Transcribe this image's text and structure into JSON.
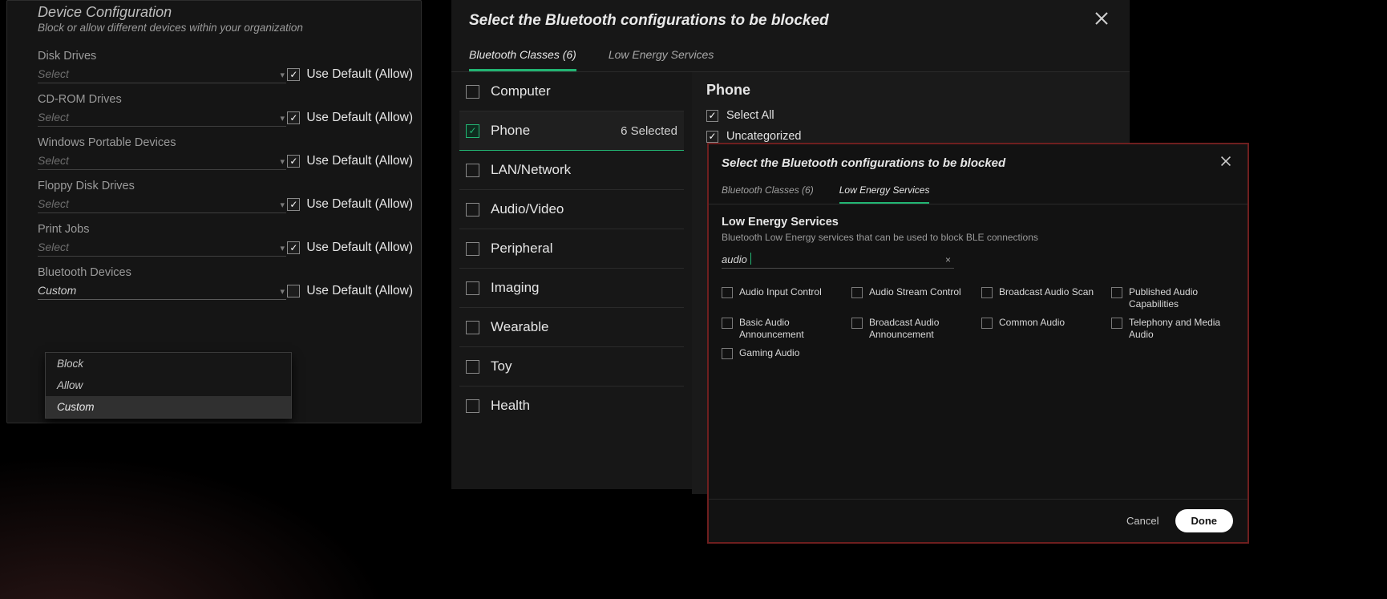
{
  "panel1": {
    "title": "Device Configuration",
    "subtitle": "Block or allow different devices within your organization",
    "select_placeholder": "Select",
    "default_label": "Use Default (Allow)",
    "fields": [
      {
        "label": "Disk Drives",
        "value": "",
        "default_checked": true
      },
      {
        "label": "CD-ROM Drives",
        "value": "",
        "default_checked": true
      },
      {
        "label": "Windows Portable Devices",
        "value": "",
        "default_checked": true
      },
      {
        "label": "Floppy Disk Drives",
        "value": "",
        "default_checked": true
      },
      {
        "label": "Print Jobs",
        "value": "",
        "default_checked": true
      },
      {
        "label": "Bluetooth Devices",
        "value": "Custom",
        "default_checked": false
      }
    ],
    "dropdown": [
      "Block",
      "Allow",
      "Custom"
    ],
    "dropdown_selected": "Custom"
  },
  "panel2": {
    "title": "Select the Bluetooth configurations to be blocked",
    "tabs": {
      "classes": "Bluetooth Classes  (6)",
      "les": "Low Energy Services"
    },
    "classes": [
      {
        "label": "Computer",
        "checked": false
      },
      {
        "label": "Phone",
        "checked": true,
        "count": "6 Selected"
      },
      {
        "label": "LAN/Network",
        "checked": false
      },
      {
        "label": "Audio/Video",
        "checked": false
      },
      {
        "label": "Peripheral",
        "checked": false
      },
      {
        "label": "Imaging",
        "checked": false
      },
      {
        "label": "Wearable",
        "checked": false
      },
      {
        "label": "Toy",
        "checked": false
      },
      {
        "label": "Health",
        "checked": false
      }
    ],
    "detail": {
      "title": "Phone",
      "select_all": "Select All",
      "items": [
        "Uncategorized"
      ]
    }
  },
  "panel3": {
    "title": "Select the Bluetooth configurations to be blocked",
    "tabs": {
      "classes": "Bluetooth Classes  (6)",
      "les": "Low Energy Services"
    },
    "section_title": "Low Energy Services",
    "section_sub": "Bluetooth Low Energy services that can be used to block BLE connections",
    "search_value": "audio",
    "services": [
      "Audio Input Control",
      "Audio Stream Control",
      "Broadcast Audio Scan",
      "Published Audio Capabilities",
      "Basic Audio Announcement",
      "Broadcast Audio Announcement",
      "Common Audio",
      "Telephony and Media Audio",
      "Gaming Audio"
    ],
    "cancel": "Cancel",
    "done": "Done"
  }
}
